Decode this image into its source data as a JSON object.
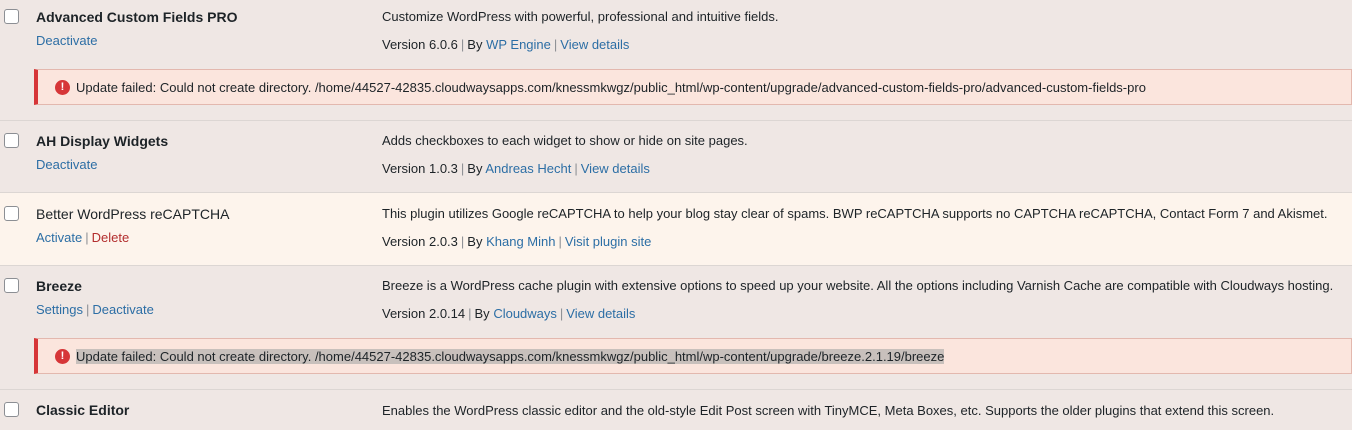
{
  "plugins": [
    {
      "name": "Advanced Custom Fields PRO",
      "actions": [
        "Deactivate"
      ],
      "description": "Customize WordPress with powerful, professional and intuitive fields.",
      "version": "Version 6.0.6",
      "by": "By",
      "author": "WP Engine",
      "details": "View details",
      "notice": "Update failed: Could not create directory. /home/44527-42835.cloudwaysapps.com/knessmkwgz/public_html/wp-content/upgrade/advanced-custom-fields-pro/advanced-custom-fields-pro"
    },
    {
      "name": "AH Display Widgets",
      "actions": [
        "Deactivate"
      ],
      "description": "Adds checkboxes to each widget to show or hide on site pages.",
      "version": "Version 1.0.3",
      "by": "By",
      "author": "Andreas Hecht",
      "details": "View details"
    },
    {
      "name": "Better WordPress reCAPTCHA",
      "actions": [
        "Activate",
        "Delete"
      ],
      "description": "This plugin utilizes Google reCAPTCHA to help your blog stay clear of spams. BWP reCAPTCHA supports no CAPTCHA reCAPTCHA, Contact Form 7 and Akismet.",
      "version": "Version 2.0.3",
      "by": "By",
      "author": "Khang Minh",
      "details": "Visit plugin site"
    },
    {
      "name": "Breeze",
      "actions": [
        "Settings",
        "Deactivate"
      ],
      "description": "Breeze is a WordPress cache plugin with extensive options to speed up your website. All the options including Varnish Cache are compatible with Cloudways hosting.",
      "version": "Version 2.0.14",
      "by": "By",
      "author": "Cloudways",
      "details": "View details",
      "notice": "Update failed: Could not create directory. /home/44527-42835.cloudwaysapps.com/knessmkwgz/public_html/wp-content/upgrade/breeze.2.1.19/breeze"
    },
    {
      "name": "Classic Editor",
      "description": "Enables the WordPress classic editor and the old-style Edit Post screen with TinyMCE, Meta Boxes, etc. Supports the older plugins that extend this screen."
    }
  ],
  "separator": "|",
  "error_glyph": "!"
}
